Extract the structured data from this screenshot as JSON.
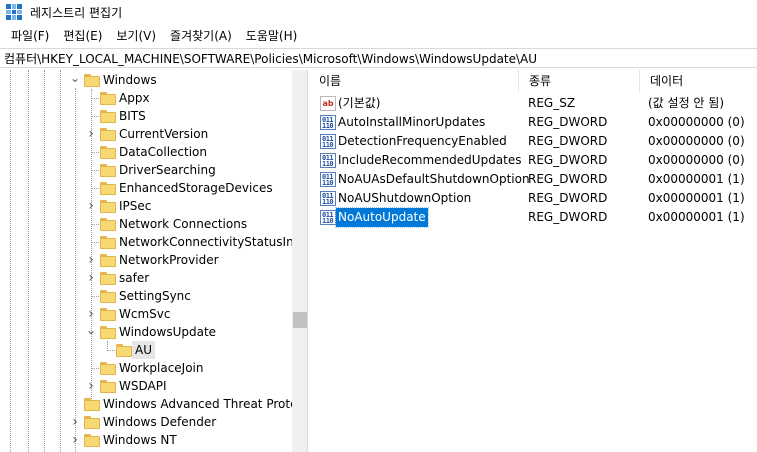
{
  "window": {
    "title": "레지스트리 편집기",
    "icon": "regedit-icon"
  },
  "menu": [
    "파일(F)",
    "편집(E)",
    "보기(V)",
    "즐겨찾기(A)",
    "도움말(H)"
  ],
  "address": "컴퓨터\\HKEY_LOCAL_MACHINE\\SOFTWARE\\Policies\\Microsoft\\Windows\\WindowsUpdate\\AU",
  "tree": [
    {
      "label": "Windows",
      "expander": "expanded"
    },
    {
      "label": "Appx",
      "expander": "none"
    },
    {
      "label": "BITS",
      "expander": "none"
    },
    {
      "label": "CurrentVersion",
      "expander": "collapsed"
    },
    {
      "label": "DataCollection",
      "expander": "none"
    },
    {
      "label": "DriverSearching",
      "expander": "none"
    },
    {
      "label": "EnhancedStorageDevices",
      "expander": "none"
    },
    {
      "label": "IPSec",
      "expander": "collapsed"
    },
    {
      "label": "Network Connections",
      "expander": "none"
    },
    {
      "label": "NetworkConnectivityStatusIndic",
      "expander": "none"
    },
    {
      "label": "NetworkProvider",
      "expander": "collapsed"
    },
    {
      "label": "safer",
      "expander": "collapsed"
    },
    {
      "label": "SettingSync",
      "expander": "none"
    },
    {
      "label": "WcmSvc",
      "expander": "collapsed"
    },
    {
      "label": "WindowsUpdate",
      "expander": "expanded"
    },
    {
      "label": "AU",
      "expander": "none",
      "selected": true
    },
    {
      "label": "WorkplaceJoin",
      "expander": "none"
    },
    {
      "label": "WSDAPI",
      "expander": "collapsed"
    },
    {
      "label": "Windows Advanced Threat Protecti",
      "expander": "none"
    },
    {
      "label": "Windows Defender",
      "expander": "collapsed"
    },
    {
      "label": "Windows NT",
      "expander": "collapsed"
    }
  ],
  "list": {
    "headers": {
      "name": "이름",
      "type": "종류",
      "data": "데이터"
    },
    "rows": [
      {
        "icon": "string-value-icon",
        "name": "(기본값)",
        "type": "REG_SZ",
        "data": "(값 설정 안 됨)"
      },
      {
        "icon": "dword-value-icon",
        "name": "AutoInstallMinorUpdates",
        "type": "REG_DWORD",
        "data": "0x00000000 (0)"
      },
      {
        "icon": "dword-value-icon",
        "name": "DetectionFrequencyEnabled",
        "type": "REG_DWORD",
        "data": "0x00000000 (0)"
      },
      {
        "icon": "dword-value-icon",
        "name": "IncludeRecommendedUpdates",
        "type": "REG_DWORD",
        "data": "0x00000000 (0)"
      },
      {
        "icon": "dword-value-icon",
        "name": "NoAUAsDefaultShutdownOption",
        "type": "REG_DWORD",
        "data": "0x00000001 (1)"
      },
      {
        "icon": "dword-value-icon",
        "name": "NoAUShutdownOption",
        "type": "REG_DWORD",
        "data": "0x00000001 (1)"
      },
      {
        "icon": "dword-value-icon",
        "name": "NoAutoUpdate",
        "type": "REG_DWORD",
        "data": "0x00000001 (1)",
        "selected": true
      }
    ]
  },
  "colors": {
    "selection": "#0078d7",
    "folder": "#f8d775"
  }
}
